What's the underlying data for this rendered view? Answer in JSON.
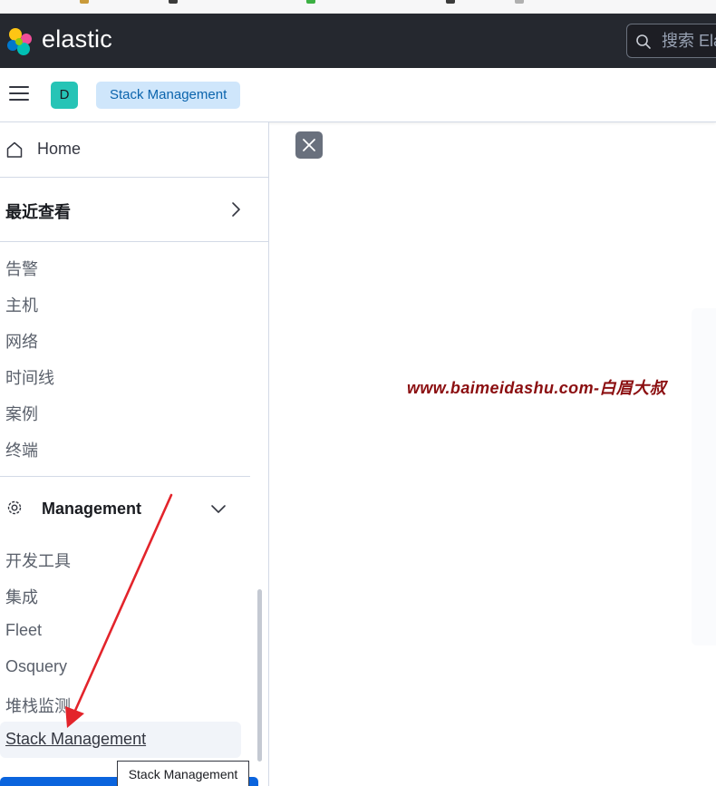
{
  "header": {
    "brand": "elastic",
    "search_placeholder": "搜索 Ela"
  },
  "subheader": {
    "space_initial": "D",
    "breadcrumb": "Stack Management"
  },
  "sidebar": {
    "home": "Home",
    "recent": "最近查看",
    "security_items": [
      "告警",
      "主机",
      "网络",
      "时间线",
      "案例",
      "终端"
    ],
    "management": {
      "title": "Management",
      "items": [
        "开发工具",
        "集成",
        "Fleet",
        "Osquery",
        "堆栈监测",
        "Stack Management"
      ]
    }
  },
  "tooltip": "Stack Management",
  "watermark": "www.baimeidashu.com-白眉大叔",
  "colors": {
    "topbar": "#25282f",
    "accent": "#0b64dd",
    "avatar": "#26c4b6",
    "breadcrumb_bg": "#cfe6fb",
    "annotation_arrow": "#e3242b",
    "watermark": "#8b0e10"
  }
}
